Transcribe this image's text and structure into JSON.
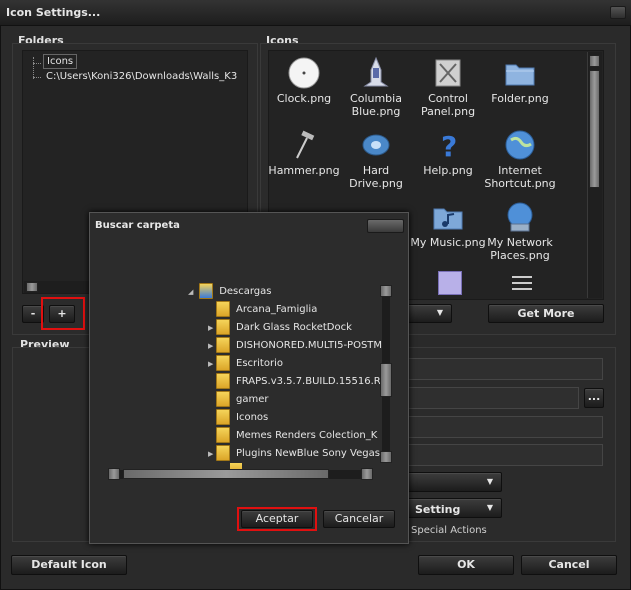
{
  "window": {
    "title": "Icon Settings..."
  },
  "folders": {
    "label": "Folders",
    "items": [
      "Icons",
      "C:\\Users\\Koni326\\Downloads\\Walls_K3"
    ],
    "remove_label": "-",
    "add_label": "+"
  },
  "icons": {
    "label": "Icons",
    "items": [
      {
        "label": "Clock.png",
        "icon": "clock-icon"
      },
      {
        "label": "Columbia Blue.png",
        "icon": "shuttle-icon"
      },
      {
        "label": "Control Panel.png",
        "icon": "control-panel-icon"
      },
      {
        "label": "Folder.png",
        "icon": "folder-icon"
      },
      {
        "label": "Hammer.png",
        "icon": "hammer-icon"
      },
      {
        "label": "Hard Drive.png",
        "icon": "hard-drive-icon"
      },
      {
        "label": "Help.png",
        "icon": "help-icon"
      },
      {
        "label": "Internet Shortcut.png",
        "icon": "globe-icon"
      },
      {
        "label": "My Music.png",
        "icon": "music-folder-icon"
      },
      {
        "label": "My Network Places.png",
        "icon": "network-icon"
      }
    ],
    "get_more_label": "Get More"
  },
  "preview": {
    "label": "Preview"
  },
  "settings": {
    "setting_select": "Setting",
    "special_actions": "Special Actions",
    "browse_label": "..."
  },
  "footer": {
    "default_icon_label": "Default Icon",
    "ok_label": "OK",
    "cancel_label": "Cancel"
  },
  "dialog": {
    "title": "Buscar carpeta",
    "root": "Descargas",
    "items": [
      {
        "label": "Arcana_Famiglia",
        "expandable": false
      },
      {
        "label": "Dark Glass RocketDock",
        "expandable": true
      },
      {
        "label": "DISHONORED.MULTI5-POSTM",
        "expandable": true
      },
      {
        "label": "Escritorio",
        "expandable": true
      },
      {
        "label": "FRAPS.v3.5.7.BUILD.15516.R",
        "expandable": false
      },
      {
        "label": "gamer",
        "expandable": false
      },
      {
        "label": "Iconos",
        "expandable": false
      },
      {
        "label": "Memes Renders Colection_K",
        "expandable": false
      },
      {
        "label": "Plugins NewBlue Sony Vegas I",
        "expandable": true
      }
    ],
    "accept_label": "Aceptar",
    "cancel_label": "Cancelar"
  },
  "colors": {
    "highlight": "#e01010",
    "background": "#2a2a2a"
  }
}
